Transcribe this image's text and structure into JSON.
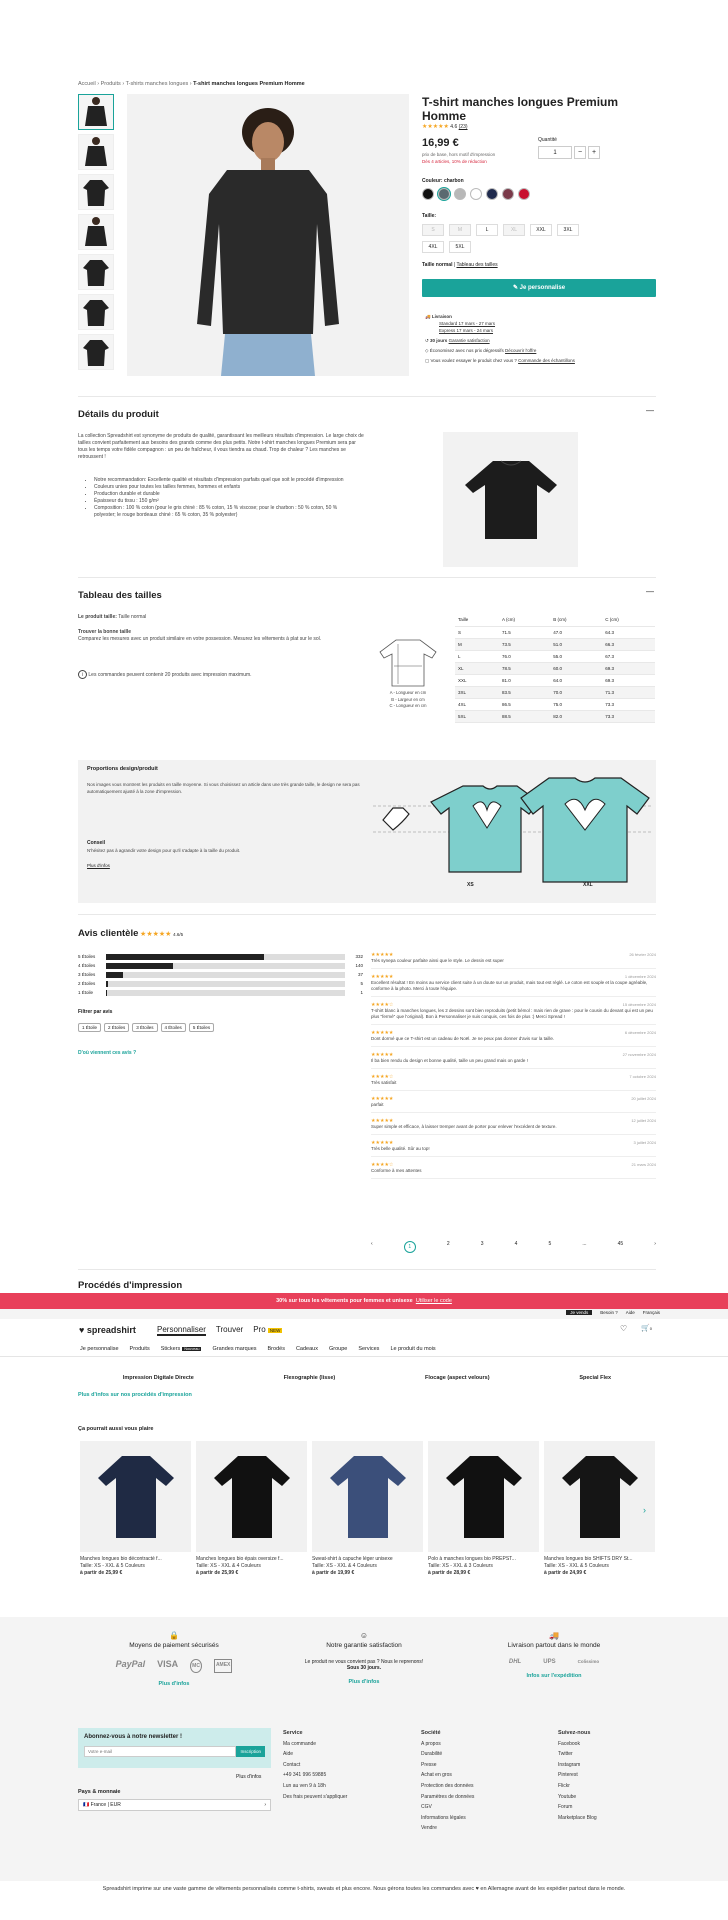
{
  "breadcrumb": {
    "items": [
      "Accueil",
      "Produits",
      "T-shirts manches longues"
    ],
    "current": "T-shirt manches longues Premium Homme"
  },
  "product": {
    "title": "T-shirt manches longues Premium Homme",
    "rating_stars": "★★★★★",
    "rating_count": "4.6",
    "rating_link": "(23)",
    "price": "16,99 €",
    "price_note": "prix de base, hors motif d'impression",
    "discount": "Dès 4 articles, 10% de réduction",
    "qty_label": "Quantité",
    "qty_value": "1",
    "minus": "−",
    "plus": "+",
    "color_label": "Couleur: charbon",
    "colors": [
      "#111111",
      "#5a6a70",
      "#b8b8b8",
      "#ffffff",
      "#1f2a4d",
      "#7a3a4a",
      "#c8102e"
    ],
    "size_label": "Taille:",
    "sizes": [
      "S",
      "M",
      "L",
      "XL",
      "XXL",
      "3XL",
      "4XL",
      "5XL"
    ],
    "size_disabled": [
      true,
      true,
      false,
      true,
      false,
      false,
      false,
      false
    ],
    "fit_label": "Taille normal",
    "fit_link": "Tableau des tailles",
    "cta": "Je personnalise",
    "delivery_title": "Livraison",
    "delivery_std": "Standard 17 mars - 27 mars",
    "delivery_exp": "Express 17 mars - 24 mars",
    "return_days": "30 jours",
    "return_link": "Garantie satisfaction",
    "eco_text": "Économisez avec nos prix dégressifs",
    "eco_link": "Découvrir l'offre",
    "sample_text": "Vous voulez essayer le produit chez vous ?",
    "sample_link": "Commande des échantillons"
  },
  "details": {
    "title": "Détails du produit",
    "toggle": "—",
    "intro": "La collection Spreadshirt est synonyme de produits de qualité, garantissant les meilleurs résultats d'impression. Le large choix de tailles convient parfaitement aux besoins des grands comme des plus petits. Notre t-shirt manches longues Premium sera par tous les temps votre fidèle compagnon : un peu de fraîcheur, il vous tiendra au chaud. Trop de chaleur ? Les manches se retroussent !",
    "bullets": [
      "Notre recommandation: Excellente qualité et résultats d'impression parfaits quel que soit le procédé d'impression",
      "Couleurs unies pour toutes les tailles femmes, hommes et enfants",
      "Production durable et durable",
      "Épaisseur du tissu : 150 g/m²",
      "Composition : 100 % coton (pour le gris chiné : 85 % coton, 15 % viscose; pour le charbon : 50 % coton, 50 % polyester; le rouge bordeaux chiné : 65 % coton, 35 % polyester)"
    ]
  },
  "sizetable": {
    "title": "Tableau des tailles",
    "toggle": "—",
    "fit_label": "Le produit taille:",
    "fit_value": "Taille normal",
    "find_title": "Trouver la bonne taille",
    "find_text": "Comparez les mesures avec un produit similaire en votre possession. Mesurez les vêtements à plat sur le sol.",
    "notice": "Les commandes peuvent contenir 20 produits avec impression maximum.",
    "legend": [
      "A - Longueur en cm",
      "B - Largeur en cm",
      "C - Longueur en cm"
    ],
    "headers": [
      "Taille",
      "A (cm)",
      "B (cm)",
      "C (cm)"
    ],
    "rows": [
      [
        "S",
        "71.5",
        "47.0",
        "64.3"
      ],
      [
        "M",
        "73.5",
        "51.0",
        "66.3"
      ],
      [
        "L",
        "76.0",
        "55.0",
        "67.3"
      ],
      [
        "XL",
        "78.5",
        "60.0",
        "69.3"
      ],
      [
        "XXL",
        "81.0",
        "64.0",
        "69.3"
      ],
      [
        "3XL",
        "83.5",
        "70.0",
        "71.3"
      ],
      [
        "4XL",
        "86.5",
        "75.0",
        "73.3"
      ],
      [
        "5XL",
        "88.5",
        "82.0",
        "73.3"
      ]
    ]
  },
  "proportions": {
    "title": "Proportions design/produit",
    "text": "Nos images vous montrent les produits en taille moyenne. Si vous choisissez un article dans une très grande taille, le design ne sera pas automatiquement ajusté à la zone d'impression.",
    "tip_title": "Conseil",
    "tip_text": "N'hésitez pas à agrandir votre design pour qu'il s'adapte à la taille du produit.",
    "tip_link": "Plus d'infos",
    "label_small": "XS",
    "label_large": "XXL"
  },
  "reviews": {
    "title": "Avis clientèle",
    "stars": "★★★★★",
    "score": "4.6/5",
    "dist": [
      {
        "label": "5 Étoiles",
        "count": "332",
        "pct": 0.66
      },
      {
        "label": "4 Étoiles",
        "count": "140",
        "pct": 0.28
      },
      {
        "label": "3 Étoiles",
        "count": "37",
        "pct": 0.07
      },
      {
        "label": "2 Étoiles",
        "count": "5",
        "pct": 0.01
      },
      {
        "label": "1 Étoile",
        "count": "1",
        "pct": 0.003
      }
    ],
    "filter_label": "Filtrer par avis",
    "filters": [
      "1 Étoile",
      "2 Étoiles",
      "3 Étoiles",
      "4 Étoiles",
      "5 Étoiles"
    ],
    "where_link": "D'où viennent ces avis ?",
    "items": [
      {
        "stars": "★★★★★",
        "date": "26 février 2024",
        "text": "Très synepa couleur parfaite ainsi que le style. Le dessin est super"
      },
      {
        "stars": "★★★★★",
        "date": "1 décembre 2024",
        "text": "Excellent résultat ! En moins au service client suite à un doute sur un produit, mais tout est réglé. Le coton est souple et la coupe agréable, conforme à la photo. Merci à toute l'équipe."
      },
      {
        "stars": "★★★★☆",
        "date": "15 décembre 2024",
        "text": "T-shirt blanc à manches longues, les 2 dessins sont bien reproduits (petit bémol : mais rien de grave : pour le cousin du devant qui est un peu plus \"fermé\" que l'original). Bon à Personnaliser je suis conquis, ces fois de plus :) Merci Spread !"
      },
      {
        "stars": "★★★★★",
        "date": "6 décembre 2024",
        "text": "Dont dormé que ce T-shirt est un cadeau de Noël. Je ne peux pas donner d'avis sur la taille."
      },
      {
        "stars": "★★★★★",
        "date": "27 novembre 2024",
        "text": "Il ba bien rendu du design et bonne qualité, taille un peu grand mais on garde !"
      },
      {
        "stars": "★★★★☆",
        "date": "7 octobre 2024",
        "text": "Très satisfait"
      },
      {
        "stars": "★★★★★",
        "date": "20 juillet 2024",
        "text": "parfait"
      },
      {
        "stars": "★★★★★",
        "date": "12 juillet 2024",
        "text": "Super simple et efficace, à laisser tremper avant de porter pour enlever l'excédent de texture."
      },
      {
        "stars": "★★★★★",
        "date": "3 juillet 2024",
        "text": "Très belle qualité. Sûr au top!"
      },
      {
        "stars": "★★★★☆",
        "date": "21 mars 2024",
        "text": "Conforme à mes attentes"
      }
    ],
    "pages": [
      "‹",
      "1",
      "2",
      "3",
      "4",
      "5",
      "...",
      "45",
      "›"
    ]
  },
  "print": {
    "title": "Procédés d'impression",
    "methods": [
      "Impression Digitale Directe",
      "Flexographie (lisse)",
      "Flocage (aspect velours)",
      "Special Flex"
    ],
    "link": "Plus d'infos sur nos procédés d'impression"
  },
  "promo": {
    "text": "30% sur tous les vêtements pour femmes et unisexe",
    "link": "Utiliser le code"
  },
  "topbar": {
    "sell": "Je vends",
    "help": "Besoin ?",
    "aide": "Aide",
    "lang": "Français"
  },
  "nav": {
    "logo": "spreadshirt",
    "tabs": [
      "Personnaliser",
      "Trouver",
      "Pro"
    ],
    "pro_badge": "NEW",
    "links": [
      "Je personnalise",
      "Produits",
      "Stickers",
      "Grandes marques",
      "Brodés",
      "Cadeaux",
      "Groupe",
      "Services",
      "Le produit du mois"
    ],
    "stickers_badge": "Nouveau",
    "cart_count": "0"
  },
  "recos": {
    "title": "Ça pourrait aussi vous plaire",
    "items": [
      {
        "name": "Manches longues bio décontracté f...",
        "sizes": "Taille: XS - XXL & 5 Couleurs",
        "price": "à partir de 25,99 €",
        "color": "#1f2a44"
      },
      {
        "name": "Manches longues bio épais oversize f...",
        "sizes": "Taille: XS - XXL & 4 Couleurs",
        "price": "à partir de 25,99 €",
        "color": "#111111"
      },
      {
        "name": "Sweat-shirt à capuche léger unisexe",
        "sizes": "Taille: XS - XXL & 4 Couleurs",
        "price": "à partir de 19,99 €",
        "color": "#3b4f7a"
      },
      {
        "name": "Polo à manches longues bio PREPST...",
        "sizes": "Taille: XS - XXL & 3 Couleurs",
        "price": "à partir de 28,99 €",
        "color": "#111111"
      },
      {
        "name": "Manches longues bio SHIFTS DRY St...",
        "sizes": "Taille: XS - XXL & 5 Couleurs",
        "price": "à partir de 24,99 €",
        "color": "#151515"
      }
    ]
  },
  "guarantee": {
    "cols": [
      {
        "title": "Moyens de paiement sécurisés",
        "link": "Plus d'infos",
        "logos": [
          "PayPal",
          "VISA",
          "MC",
          "AMEX"
        ]
      },
      {
        "title": "Notre garantie satisfaction",
        "text": "Le produit ne vous convient pas ? Nous le reprenons!",
        "strong": "Sous 30 jours.",
        "link": "Plus d'infos"
      },
      {
        "title": "Livraison partout dans le monde",
        "link": "Infos sur l'expédition",
        "logos": [
          "DHL",
          "UPS",
          "Colissimo"
        ]
      }
    ]
  },
  "footer": {
    "newsletter_title": "Abonnez-vous à notre newsletter !",
    "newsletter_placeholder": "Votre e-mail",
    "newsletter_btn": "Inscription",
    "more_info": "Plus d'infos",
    "country_label": "Pays & monnaie",
    "country_value": "France | EUR",
    "cols": [
      {
        "title": "Service",
        "items": [
          "Ma commande",
          "Aide",
          "Contact",
          "+49 341 996 59885",
          "Lun au ven 9 à 18h",
          "Des frais peuvent s'appliquer"
        ]
      },
      {
        "title": "Société",
        "items": [
          "A propos",
          "Durabilité",
          "Presse",
          "Achat en gros",
          "Protection des données",
          "Paramètres de données",
          "CGV",
          "Informations légales",
          "Vendre"
        ]
      },
      {
        "title": "Suivez-nous",
        "items": [
          "Facebook",
          "Twitter",
          "Instagram",
          "Pinterest",
          "Flickr",
          "Youtube",
          "Forum",
          "Marketplace Blog"
        ]
      }
    ],
    "bottom": "Spreadshirt imprime sur une vaste gamme de vêtements personnalisés comme t-shirts, sweats et plus encore. Nous gérons toutes les commandes avec ♥ en Allemagne avant de les expédier partout dans le monde."
  }
}
